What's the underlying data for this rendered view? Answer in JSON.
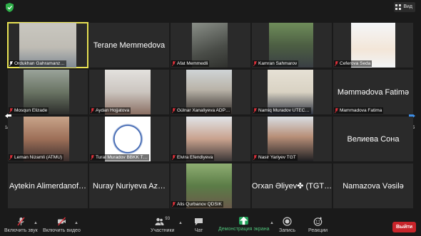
{
  "header": {
    "view_label": "Вид"
  },
  "colors": {
    "active_border": "#e8e253",
    "muted_mic": "#e0303a",
    "share_green": "#23a25a",
    "leave_red": "#c8242a"
  },
  "pager": {
    "page": "1/5"
  },
  "participants": [
    {
      "name": "Ordukhan Gahramanz…",
      "type": "video",
      "active": true
    },
    {
      "name": "Terane Memmedova",
      "type": "name"
    },
    {
      "name": "Afat Memmedli",
      "type": "video"
    },
    {
      "name": "Kamran Sahmarov",
      "type": "video"
    },
    {
      "name": "Ceferova Seda",
      "type": "video"
    },
    {
      "name": "Mosqun Elizade",
      "type": "video"
    },
    {
      "name": "Aydan Hojjatova",
      "type": "video"
    },
    {
      "name": "Gülnar Xanaliyeva ADP…",
      "type": "video"
    },
    {
      "name": "Namiq Muradov UTEC…",
      "type": "video"
    },
    {
      "name": "Məmmədova Fatimə",
      "type": "name",
      "caption": "Mammadova Fatima"
    },
    {
      "name": "Leman Nizamli (ATMU)",
      "type": "video"
    },
    {
      "name": "Tural Muradov BBKK T…",
      "type": "video"
    },
    {
      "name": "Elvira Efendiyeva",
      "type": "video"
    },
    {
      "name": "Nasir Yariyev TGT",
      "type": "video"
    },
    {
      "name": "Велиева Сона",
      "type": "name"
    },
    {
      "name": "Aytekin Alimerdanof…",
      "type": "name"
    },
    {
      "name": "Nuray Nuriyeva Az…",
      "type": "name"
    },
    {
      "name": "Alis Qurbanov QDSIK",
      "type": "video"
    },
    {
      "name": "Orxan Əliyev✤ (TGT…",
      "type": "name"
    },
    {
      "name": "Namazova Vəsilə",
      "type": "name"
    }
  ],
  "toolbar": {
    "mute": "Включить звук",
    "video": "Включить видео",
    "participants": "Участники",
    "participants_count": "93",
    "chat": "Чат",
    "share": "Демонстрация экрана",
    "record": "Запись",
    "reactions": "Реакции",
    "leave": "Выйти"
  }
}
